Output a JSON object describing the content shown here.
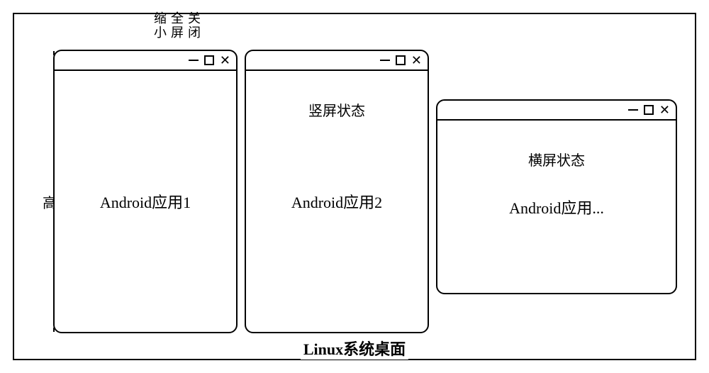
{
  "labels": {
    "minimize": "缩小",
    "fullscreen": "全屏",
    "close": "关闭",
    "height": "高",
    "desktop": "Linux系统桌面"
  },
  "windows": [
    {
      "name": "Android应用1",
      "orientation": "",
      "shape": "portrait"
    },
    {
      "name": "Android应用2",
      "orientation": "竖屏状态",
      "shape": "portrait"
    },
    {
      "name": "Android应用...",
      "orientation": "横屏状态",
      "shape": "landscape"
    }
  ]
}
